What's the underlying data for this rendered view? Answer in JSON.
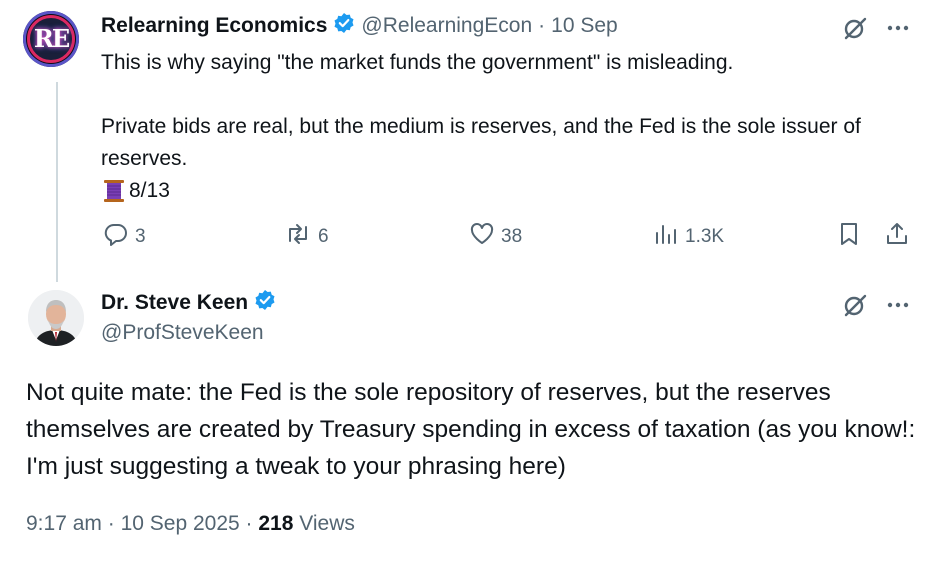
{
  "parent_tweet": {
    "author_name": "Relearning Economics",
    "handle": "@RelearningEcon",
    "separator": "·",
    "date": "10 Sep",
    "avatar_text": "RE",
    "text_line_1": "This is why saying \"the market funds the government\" is misleading.",
    "text_line_2": "Private bids are real, but the medium is reserves, and the Fed is the sole issuer of reserves.",
    "thread_counter": "8/13",
    "replies": "3",
    "reposts": "6",
    "likes": "38",
    "views": "1.3K"
  },
  "reply_tweet": {
    "author_name": "Dr. Steve Keen",
    "handle": "@ProfSteveKeen",
    "text": "Not quite mate: the Fed is the sole repository of reserves, but the reserves themselves are created by Treasury spending in excess of taxation (as you know!: I'm just suggesting a tweak to your phrasing here)",
    "time": "9:17 am",
    "date": "10 Sep 2025",
    "views_count": "218",
    "views_label": "Views",
    "separator": "·"
  },
  "colors": {
    "text_primary": "#0f1419",
    "text_secondary": "#536471",
    "verified_blue": "#1d9bf0",
    "thread_line": "#cfd9de"
  },
  "icons": [
    "verified-badge-icon",
    "grok-icon",
    "more-icon",
    "thread-spool-icon",
    "reply-icon",
    "repost-icon",
    "like-icon",
    "views-icon",
    "bookmark-icon",
    "share-icon"
  ]
}
